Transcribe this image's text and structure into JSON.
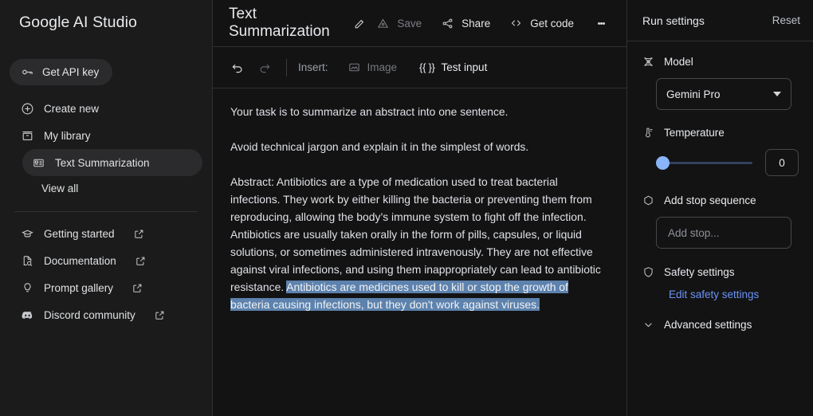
{
  "sidebar": {
    "brand": "Google AI Studio",
    "api_key_button": "Get API key",
    "items": [
      {
        "label": "Create new",
        "icon": "plus-circle-icon"
      },
      {
        "label": "My library",
        "icon": "library-icon"
      }
    ],
    "library_item": "Text Summarization",
    "view_all": "View all",
    "links": [
      {
        "label": "Getting started",
        "icon": "graduation-cap-icon"
      },
      {
        "label": "Documentation",
        "icon": "document-search-icon"
      },
      {
        "label": "Prompt gallery",
        "icon": "lightbulb-icon"
      },
      {
        "label": "Discord community",
        "icon": "discord-icon"
      }
    ]
  },
  "header": {
    "title": "Text Summarization",
    "edit_icon": "pencil-icon",
    "save_label": "Save",
    "share_label": "Share",
    "get_code_label": "Get code",
    "more_icon": "kebab-menu-icon"
  },
  "toolbar": {
    "undo_icon": "undo-icon",
    "redo_icon": "redo-icon",
    "insert_label": "Insert:",
    "image_label": "Image",
    "braces": "{{ }}",
    "test_input_label": "Test input"
  },
  "prompt": {
    "line1": "Your task is to summarize an abstract into one sentence.",
    "line2": "Avoid technical jargon and explain it in the simplest of words.",
    "line3_plain": "Abstract: Antibiotics are a type of medication used to treat bacterial infections. They work by either killing the bacteria or preventing them from reproducing, allowing the body’s immune system to fight off the infection. Antibiotics are usually taken orally in the form of pills, capsules, or liquid solutions, or sometimes administered intravenously. They are not effective against viral infections, and using them inappropriately can lead to antibiotic resistance. ",
    "line3_selected": "Antibiotics are medicines used to kill or stop the growth of bacteria causing infections, but they don't work against viruses."
  },
  "run_settings": {
    "title": "Run settings",
    "reset_label": "Reset",
    "model_label": "Model",
    "model_icon": "model-atom-icon",
    "model_value": "Gemini Pro",
    "temperature_label": "Temperature",
    "temperature_icon": "thermometer-icon",
    "temperature_value": "0",
    "stop_sequence_label": "Add stop sequence",
    "stop_sequence_icon": "hexagon-icon",
    "stop_placeholder": "Add stop...",
    "safety_label": "Safety settings",
    "safety_icon": "shield-icon",
    "edit_safety_link": "Edit safety settings",
    "advanced_label": "Advanced settings",
    "advanced_icon": "chevron-down-icon"
  },
  "colors": {
    "selection_highlight": "#5d82ad",
    "accent_link": "#6b93f6",
    "slider_thumb": "#8ab4f8",
    "panel_bg": "#131314",
    "sidebar_bg": "#1b1b1b"
  }
}
